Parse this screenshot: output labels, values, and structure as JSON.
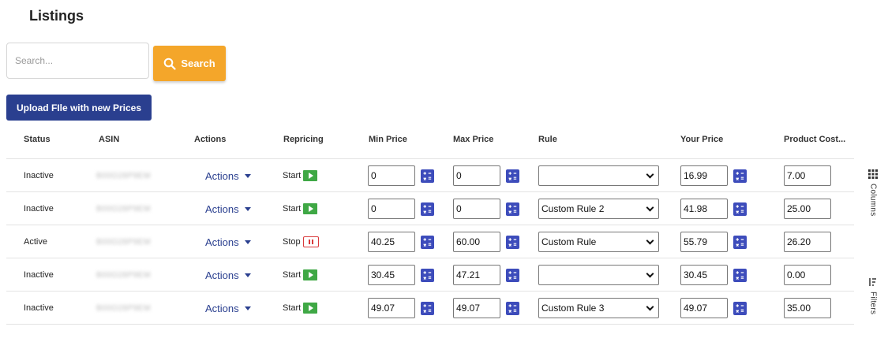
{
  "page": {
    "title": "Listings"
  },
  "search": {
    "placeholder": "Search...",
    "button_label": "Search"
  },
  "upload": {
    "label": "Upload FIle with new Prices"
  },
  "side_panel": {
    "columns_label": "Columns",
    "filters_label": "Filters"
  },
  "table": {
    "headers": [
      "Status",
      "ASIN",
      "Actions",
      "Repricing",
      "Min Price",
      "Max Price",
      "Rule",
      "Your Price",
      "Product Cost..."
    ],
    "rows": [
      {
        "status": "Inactive",
        "asin": "B00O28P9EM",
        "actions": "Actions",
        "repricing_label": "Start",
        "min_price": "0",
        "max_price": "0",
        "rule": "",
        "your_price": "16.99",
        "product_cost": "7.00"
      },
      {
        "status": "Inactive",
        "asin": "B00O28P9EM",
        "actions": "Actions",
        "repricing_label": "Start",
        "min_price": "0",
        "max_price": "0",
        "rule": "Custom Rule 2",
        "your_price": "41.98",
        "product_cost": "25.00"
      },
      {
        "status": "Active",
        "asin": "B00O28P9EM",
        "actions": "Actions",
        "repricing_label": "Stop",
        "min_price": "40.25",
        "max_price": "60.00",
        "rule": "Custom Rule",
        "your_price": "55.79",
        "product_cost": "26.20"
      },
      {
        "status": "Inactive",
        "asin": "B00O28P9EM",
        "actions": "Actions",
        "repricing_label": "Start",
        "min_price": "30.45",
        "max_price": "47.21",
        "rule": "",
        "your_price": "30.45",
        "product_cost": "0.00"
      },
      {
        "status": "Inactive",
        "asin": "B00O28P9EM",
        "actions": "Actions",
        "repricing_label": "Start",
        "min_price": "49.07",
        "max_price": "49.07",
        "rule": "Custom Rule 3",
        "your_price": "49.07",
        "product_cost": "35.00"
      }
    ]
  },
  "colors": {
    "search_button": "#f4a62a",
    "upload_button": "#2a3f8f",
    "start_button": "#3fa845",
    "stop_button": "#d9393b",
    "calculator_icon": "#3d4cbb"
  },
  "icons": {
    "search": "search-icon",
    "calculator": "calculator-icon",
    "play": "play-icon",
    "pause": "pause-icon",
    "caret": "caret-down-icon",
    "columns": "grid-icon",
    "filters": "filter-icon"
  }
}
